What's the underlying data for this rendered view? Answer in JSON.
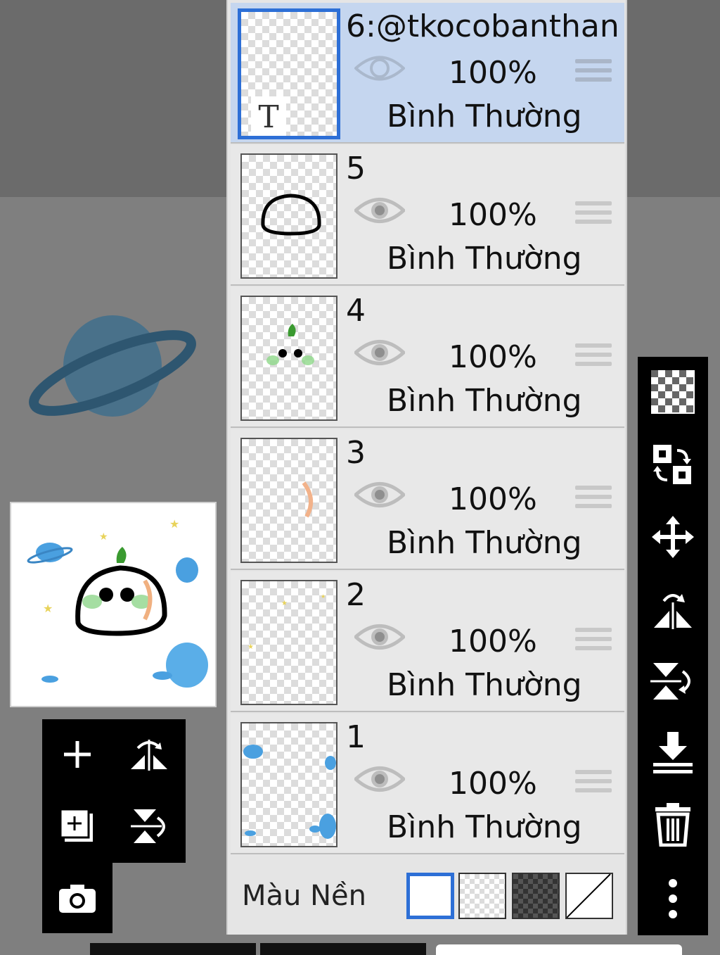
{
  "layers_panel": {
    "layers": [
      {
        "name": "6:@tkocobanthan",
        "opacity": "100%",
        "blend": "Bình Thường",
        "visible": true,
        "selected": true,
        "type": "text",
        "thumb_glyph": "T"
      },
      {
        "name": "5",
        "opacity": "100%",
        "blend": "Bình Thường",
        "visible": true,
        "selected": false
      },
      {
        "name": "4",
        "opacity": "100%",
        "blend": "Bình Thường",
        "visible": true,
        "selected": false
      },
      {
        "name": "3",
        "opacity": "100%",
        "blend": "Bình Thường",
        "visible": true,
        "selected": false
      },
      {
        "name": "2",
        "opacity": "100%",
        "blend": "Bình Thường",
        "visible": true,
        "selected": false
      },
      {
        "name": "1",
        "opacity": "100%",
        "blend": "Bình Thường",
        "visible": true,
        "selected": false
      }
    ],
    "background": {
      "label": "Màu Nền",
      "selected": "white",
      "options": [
        "white",
        "transparent",
        "dark-checker",
        "none"
      ]
    }
  },
  "left_toolbar": [
    "add-layer-icon",
    "flip-horizontal-icon",
    "add-copy-layer-icon",
    "flip-vertical-icon",
    "camera-icon"
  ],
  "right_toolbar": [
    "transparency-icon",
    "swap-icon",
    "move-icon",
    "flip-horizontal-icon",
    "flip-vertical-icon",
    "merge-down-icon",
    "trash-icon",
    "more-icon"
  ],
  "colors": {
    "accent": "#2d6fd6",
    "selected_row": "#c5d6ef",
    "panel": "#e5e5e5",
    "toolbar": "#000000"
  }
}
